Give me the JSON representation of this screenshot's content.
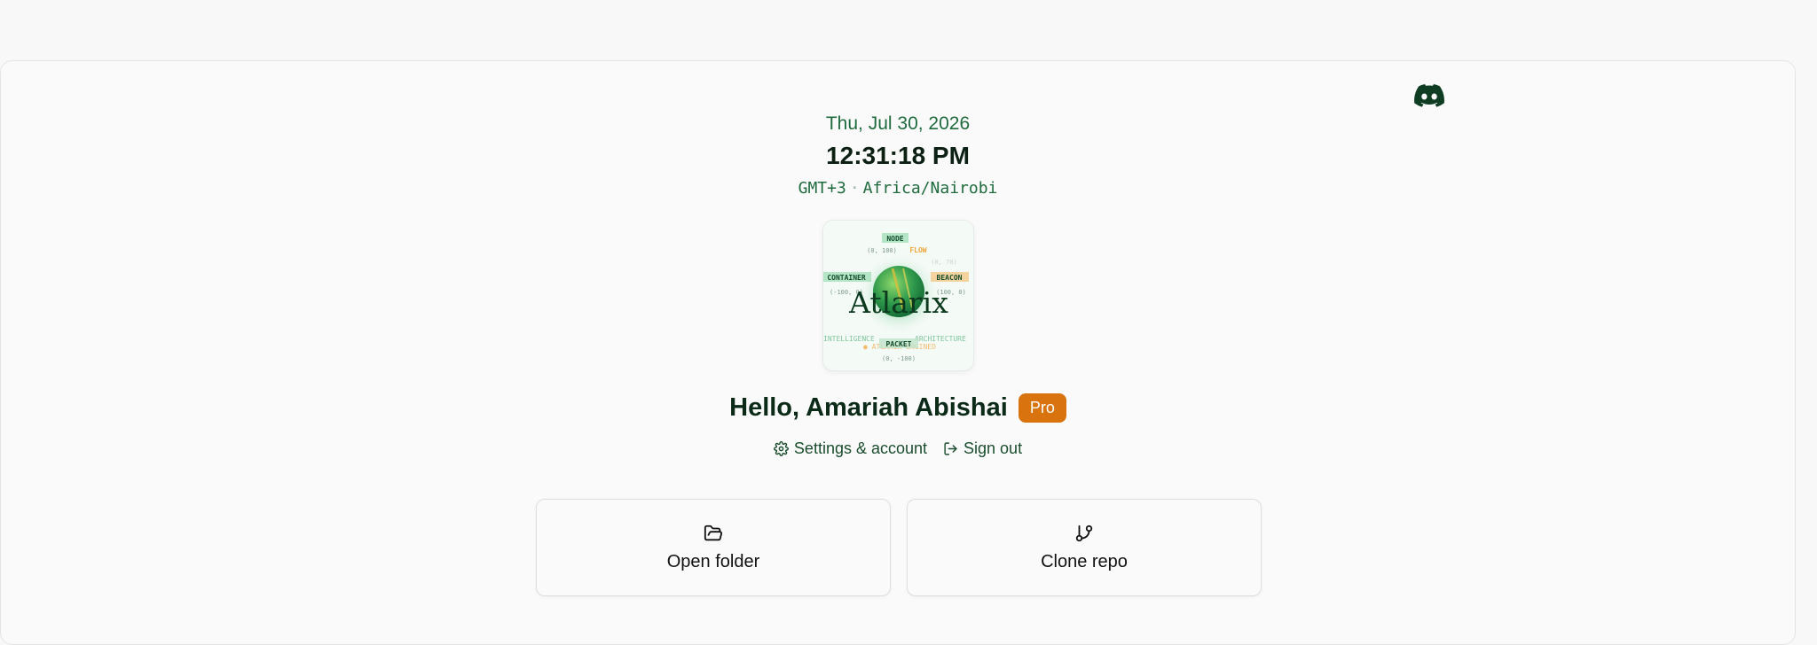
{
  "header": {
    "date": "Thu, Jul 30, 2026",
    "time": "12:31:18 PM",
    "gmt": "GMT+3",
    "tz_separator": "·",
    "timezone": "Africa/Nairobi"
  },
  "logo": {
    "wordmark": "Atlarix",
    "labels": {
      "node": "NODE",
      "node_coord": "(0, 100)",
      "flow": "FLOW",
      "flow_coord": "(0, 70)",
      "container": "CONTAINER",
      "container_coord": "(-100, 0)",
      "beacon": "BEACON",
      "beacon_coord": "(100, 0)",
      "intelligence": "INTELLIGENCE",
      "architecture": "ARCHITECTURE",
      "packet": "PACKET",
      "packet_coord": "(0, -100)",
      "tagline": "● ATLARIX ENGINED"
    }
  },
  "user": {
    "greeting": "Hello, Amariah Abishai",
    "plan_badge": "Pro"
  },
  "links": {
    "settings": "Settings & account",
    "signout": "Sign out"
  },
  "actions": {
    "open_folder": "Open folder",
    "clone_repo": "Clone repo"
  },
  "icons": {
    "discord": "discord-icon",
    "settings": "gear-icon",
    "signout": "sign-out-icon",
    "folder": "folder-open-icon",
    "clone": "git-branch-icon"
  },
  "colors": {
    "accent_green": "#1f6b3e",
    "dark_text": "#0c2a18",
    "pro_badge": "#d9730d",
    "beacon_orange": "#f0a63a"
  }
}
